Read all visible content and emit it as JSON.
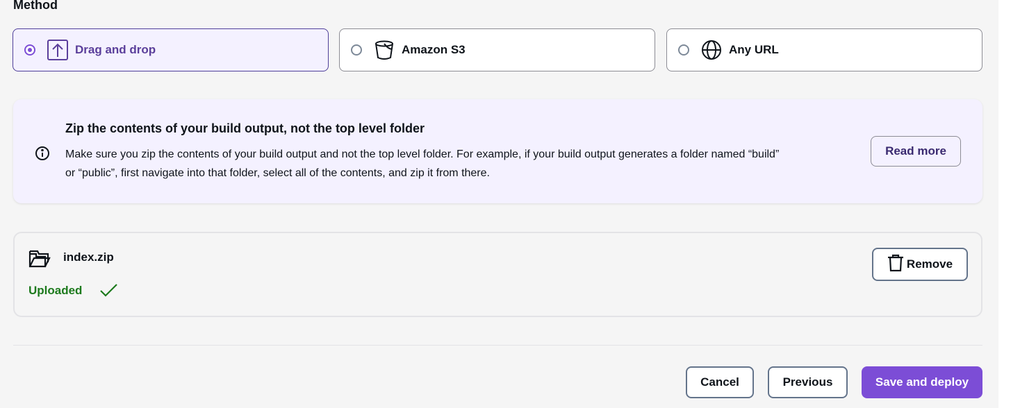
{
  "method": {
    "title": "Method",
    "options": [
      {
        "label": "Drag and drop",
        "icon": "upload-icon",
        "selected": true
      },
      {
        "label": "Amazon S3",
        "icon": "bucket-icon",
        "selected": false
      },
      {
        "label": "Any URL",
        "icon": "globe-icon",
        "selected": false
      }
    ]
  },
  "alert": {
    "icon": "info-icon",
    "title": "Zip the contents of your build output, not the top level folder",
    "body": "Make sure you zip the contents of your build output and not the top level folder. For example, if your build output generates a folder named “build” or “public”, first navigate into that folder, select all of the contents, and zip it from there.",
    "read_more_label": "Read more"
  },
  "file": {
    "icon": "folder-icon",
    "name": "index.zip",
    "status": "Uploaded",
    "status_icon": "check-icon",
    "remove_label": "Remove",
    "remove_icon": "trash-icon"
  },
  "footer": {
    "cancel_label": "Cancel",
    "previous_label": "Previous",
    "save_label": "Save and deploy"
  },
  "colors": {
    "accent": "#7c4dd6",
    "selected_bg": "#f4f1ff",
    "success": "#1d7a1d"
  }
}
